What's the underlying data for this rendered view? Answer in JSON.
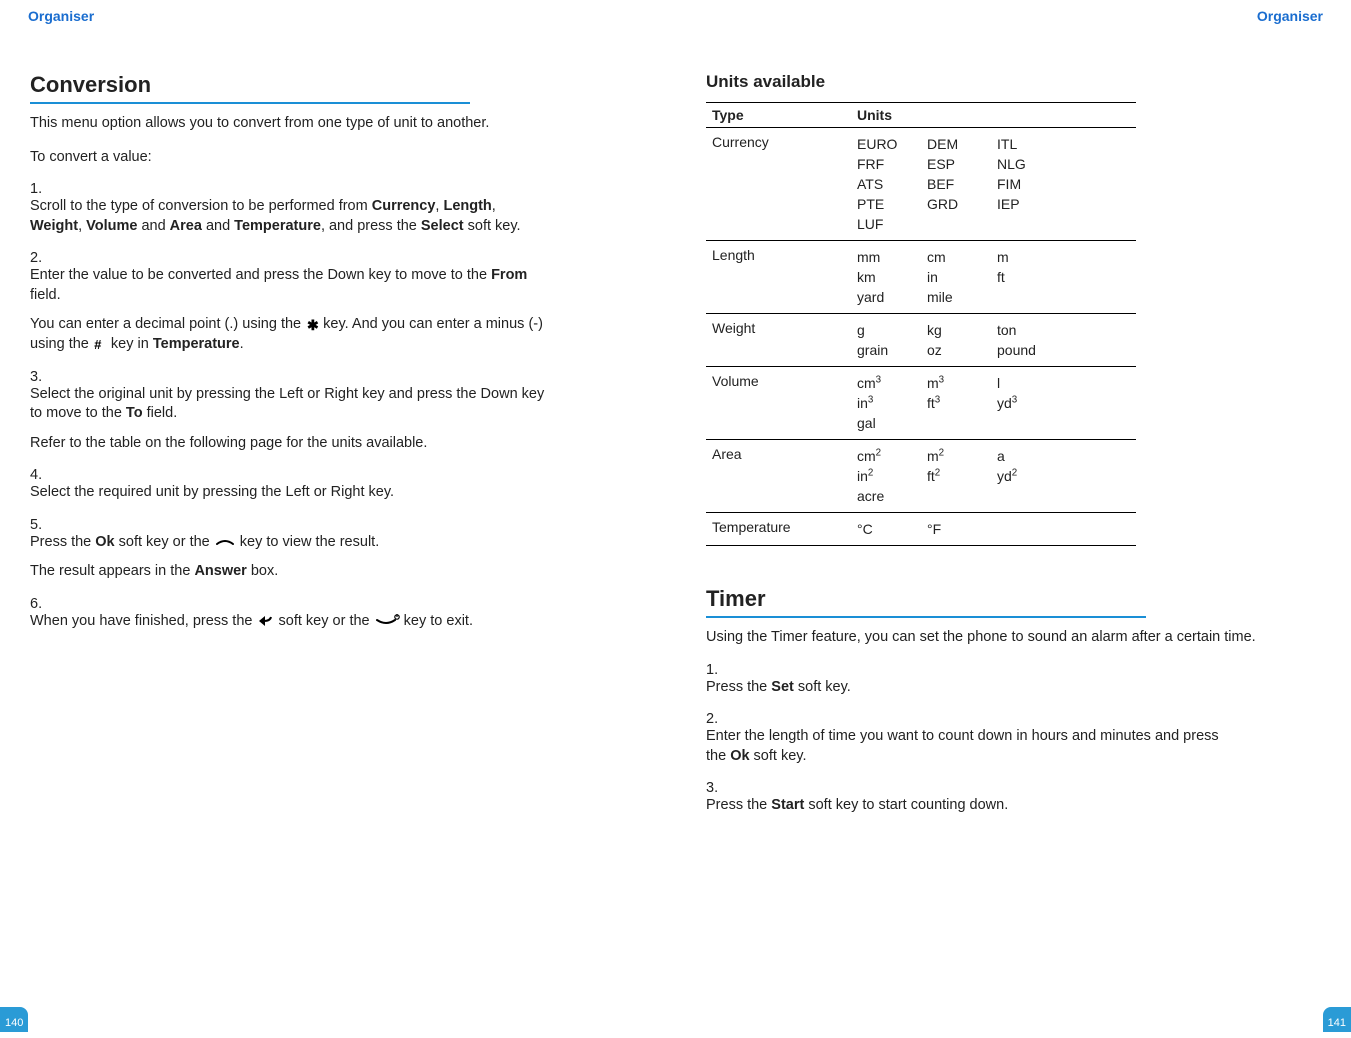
{
  "left": {
    "header": "Organiser",
    "page_number": "140",
    "section_title": "Conversion",
    "intro": "This menu option allows you to convert from one type of unit to another.",
    "lead": "To convert a value:",
    "bold": {
      "currency": "Currency",
      "length": "Length",
      "weight": "Weight",
      "volume": "Volume",
      "area": "Area",
      "temperature": "Temperature",
      "select": "Select",
      "from": "From",
      "to": "To",
      "ok": "Ok",
      "answer": "Answer"
    },
    "s1_a": "Scroll to the type of conversion to be performed from ",
    "s1_b": ", ",
    "s1_c": ", ",
    "s1_d": ", ",
    "s1_e": " and ",
    "s1_f": ", and press the ",
    "s1_g": " soft key.",
    "s2_a": "Enter the value to be converted and press the Down key to move to the ",
    "s2_b": " field.",
    "s2p_a": "You can enter a decimal point (.) using the ",
    "s2p_b": " key. And you can enter a minus (-) using the ",
    "s2p_c": " key in ",
    "s2p_d": ".",
    "s3_a": "Select the original unit by pressing the Left or Right key and press the Down key to move to the ",
    "s3_b": " field.",
    "s3p": "Refer to the table on the following page for the units available.",
    "s4": "Select the required unit by pressing the Left or Right key.",
    "s5_a": "Press the ",
    "s5_b": " soft key or the ",
    "s5_c": " key to view the result.",
    "s5p_a": "The result appears in the ",
    "s5p_b": " box.",
    "s6_a": "When you have finished, press the ",
    "s6_b": " soft key or the ",
    "s6_c": " key to exit."
  },
  "right": {
    "header": "Organiser",
    "page_number": "141",
    "units_title": "Units available",
    "th_type": "Type",
    "th_units": "Units",
    "rows": {
      "currency": "Currency",
      "length": "Length",
      "weight": "Weight",
      "volume": "Volume",
      "area": "Area",
      "temperature": "Temperature"
    },
    "currency_units": [
      "EURO",
      "DEM",
      "ITL",
      "FRF",
      "ESP",
      "NLG",
      "ATS",
      "BEF",
      "FIM",
      "PTE",
      "GRD",
      "IEP",
      "LUF"
    ],
    "length_units": [
      "mm",
      "cm",
      "m",
      "km",
      "in",
      "ft",
      "yard",
      "mile"
    ],
    "weight_units": [
      "g",
      "kg",
      "ton",
      "grain",
      "oz",
      "pound"
    ],
    "volume_units_html": [
      "cm<sup>3</sup>",
      "m<sup>3</sup>",
      "l",
      "in<sup>3</sup>",
      "ft<sup>3</sup>",
      "yd<sup>3</sup>",
      "gal"
    ],
    "area_units_html": [
      "cm<sup>2</sup>",
      "m<sup>2</sup>",
      "a",
      "in<sup>2</sup>",
      "ft<sup>2</sup>",
      "yd<sup>2</sup>",
      "acre"
    ],
    "temp_units": [
      "°C",
      "°F"
    ],
    "timer_title": "Timer",
    "timer_intro": "Using the Timer feature, you can set the phone to sound an alarm after a certain time.",
    "t_bold": {
      "set": "Set",
      "ok": "Ok",
      "start": "Start"
    },
    "t1_a": "Press the ",
    "t1_b": " soft key.",
    "t2_a": "Enter the length of time you want to count down in hours and minutes and press the ",
    "t2_b": " soft key.",
    "t3_a": "Press the ",
    "t3_b": " soft key to start counting down."
  }
}
